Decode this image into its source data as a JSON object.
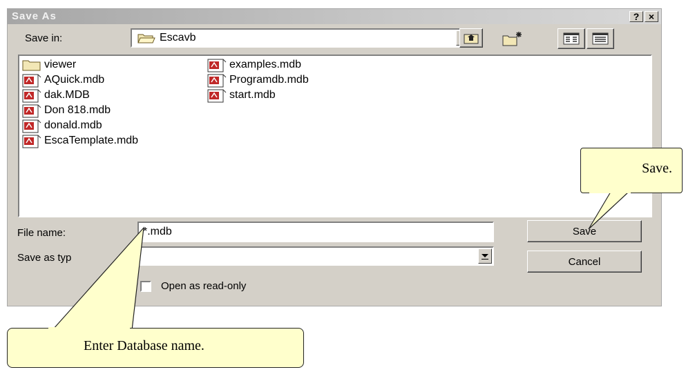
{
  "window": {
    "title": "Save As",
    "help_label": "?",
    "close_label": "×"
  },
  "save_in": {
    "label": "Save in:",
    "value": "Escavb"
  },
  "files": [
    {
      "name": "viewer",
      "kind": "folder"
    },
    {
      "name": "AQuick.mdb",
      "kind": "mdb"
    },
    {
      "name": "dak.MDB",
      "kind": "mdb"
    },
    {
      "name": "Don 818.mdb",
      "kind": "mdb"
    },
    {
      "name": "donald.mdb",
      "kind": "mdb"
    },
    {
      "name": "EscaTemplate.mdb",
      "kind": "mdb"
    },
    {
      "name": "examples.mdb",
      "kind": "mdb"
    },
    {
      "name": "Programdb.mdb",
      "kind": "mdb"
    },
    {
      "name": "start.mdb",
      "kind": "mdb"
    }
  ],
  "file_name": {
    "label": "File name:",
    "value": "*.mdb"
  },
  "save_as_type": {
    "label": "Save as typ",
    "value": ""
  },
  "read_only": {
    "label": "Open as read-only",
    "checked": false
  },
  "buttons": {
    "save": "Save",
    "cancel": "Cancel"
  },
  "callouts": {
    "save": "Save.",
    "enter_name": "Enter Database name."
  },
  "colors": {
    "dialog_face": "#d4d0c8",
    "callout_fill": "#ffffcc",
    "mdb_icon": "#c02828"
  }
}
